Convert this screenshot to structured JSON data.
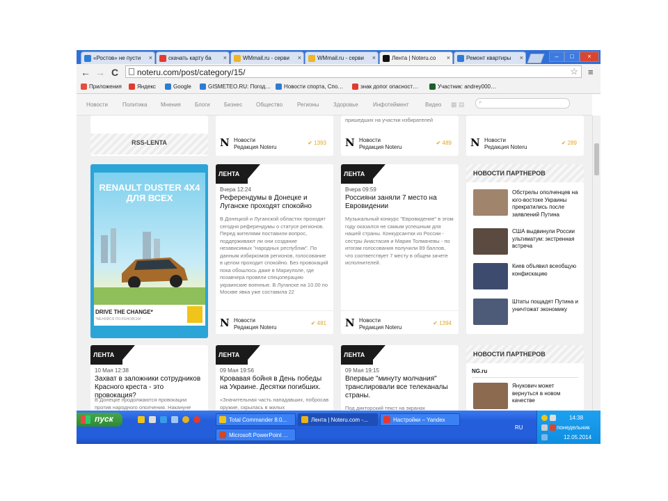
{
  "browser": {
    "tabs": [
      {
        "label": "«Ростов» не пусти",
        "icon_color": "#2e7bd6"
      },
      {
        "label": "скачать карту ба",
        "icon_color": "#e23b2e"
      },
      {
        "label": "WMmail.ru - серви",
        "icon_color": "#f0b429"
      },
      {
        "label": "WMmail.ru - серви",
        "icon_color": "#f0b429"
      },
      {
        "label": "Лента | Noteru.co",
        "icon_color": "#111111"
      },
      {
        "label": "Ремонт квартиры",
        "icon_color": "#2e7bd6"
      }
    ],
    "close_glyph": "×",
    "window_buttons": [
      "–",
      "□",
      "×"
    ],
    "url": "noteru.com/post/category/15/",
    "nav": {
      "back": "←",
      "forward": "→",
      "reload": "C",
      "star": "☆",
      "menu": "≡"
    }
  },
  "bookmarks": [
    {
      "label": "Приложения",
      "icon_color": "#e74c3c"
    },
    {
      "label": "Яндекс",
      "icon_color": "#e23b2e"
    },
    {
      "label": "Google",
      "icon_color": "#2e7bd6"
    },
    {
      "label": "GISMETEO.RU: Погод…",
      "icon_color": "#2e7bd6"
    },
    {
      "label": "Новости спорта, Спо…",
      "icon_color": "#2e7bd6"
    },
    {
      "label": "знак допог опасност…",
      "icon_color": "#e23b2e"
    },
    {
      "label": "Участник: andrey000…",
      "icon_color": "#1a5e2a"
    }
  ],
  "sitenav": [
    "Новости",
    "Политика",
    "Мнения",
    "Блоги",
    "Бизнес",
    "Общество",
    "Регионы",
    "Здоровье",
    "Инфотеймент",
    "Видео"
  ],
  "top_row": {
    "rss_label": "RSS-LENTA",
    "partial_text_3": "пришедших на участки избирателей",
    "cards": [
      {
        "source": "Новости",
        "editor": "Редакция Noteru",
        "count": "1393"
      },
      {
        "source": "Новости",
        "editor": "Редакция Noteru",
        "count": "489"
      },
      {
        "source": "Новости",
        "editor": "Редакция Noteru",
        "count": "289"
      }
    ]
  },
  "ad": {
    "title": "RENAULT DUSTER 4X4 ДЛЯ ВСЕХ",
    "slogan": "DRIVE THE CHANGE*",
    "subtext": "*МЕНЯЙСЯ ПО-РЕНОВСКИ"
  },
  "lenta_label": "ЛЕНТА",
  "mid_row": [
    {
      "date": "Вчера 12:24",
      "title": "Референдумы в Донецке и Луганске проходят спокойно",
      "body": "В Донецкой и Луганской областях проходят сегодня референдумы о статусе регионов. Перед жителями поставили вопрос, поддерживают ли они создание независимых \"народных республик\". По данным избиркомов регионов, голосование в целом проходит спокойно. Без провокаций пока обошлось даже в Мариуполе, где позавчера провели спецоперацию украинские военные. В Луганске на 10.00 по Москве явка уже составила 22",
      "source": "Новости",
      "editor": "Редакция Noteru",
      "count": "481"
    },
    {
      "date": "Вчера 09:59",
      "title": "Россияни заняли 7 место на Евровидении",
      "body": "Музыкальный конкурс \"Евровидение\" в этом году оказался не самым успешным для нашей страны. Конкурсантки из России - сестры Анастасия и Мария Толмачевы - по итогам голосования получили 89 баллов, что соответствует 7 месту в общем зачете исполнителей.",
      "source": "Новости",
      "editor": "Редакция Noteru",
      "count": "1394"
    }
  ],
  "partners1": {
    "title": "НОВОСТИ ПАРТНЕРОВ",
    "items": [
      {
        "text": "Обстрелы ополченцев на юго-востоке Украины прекратились после заявлений Путина",
        "color": "#a0846c"
      },
      {
        "text": "США выдвинули России ультиматум: экстренная встреча",
        "color": "#5b4a3f"
      },
      {
        "text": "Киев объявил всеобщую конфискацию",
        "color": "#3d4c6e"
      },
      {
        "text": "Штаты пощадят Путина и уничтожат экономику",
        "color": "#4d5a78"
      }
    ]
  },
  "bottom_row": [
    {
      "date": "10 Мая 12:38",
      "title": "Захват в заложники сотрудников Красного креста - это провокация?",
      "body": "В Донецке продолжаются провокации против народного ополчения. Накануне"
    },
    {
      "date": "09 Мая 19:56",
      "title": "Кровавая бойня в День победы на Украине. Десятки погибших.",
      "body": "«Значительная часть нападавших, побросав оружие, скрылась в жилых"
    },
    {
      "date": "09 Мая 19:15",
      "title": "Впервые \"минуту молчания\" транслировали все телеканалы страны.",
      "body": "Под дикторский текст на экранах"
    }
  ],
  "partners2": {
    "title": "НОВОСТИ ПАРТНЕРОВ",
    "source": "NG.ru",
    "items": [
      {
        "text": "Янукович может вернуться в новом качестве",
        "color": "#8b6a4f"
      }
    ]
  },
  "taskbar": {
    "start_label": "пуск",
    "buttons": [
      {
        "label": "Total Commander 8.0...",
        "icon_color": "#f0c419",
        "active": false
      },
      {
        "label": "Лента | Noteru.com -...",
        "icon_color": "#e8b21c",
        "active": true
      },
      {
        "label": "Настройки – Yandex",
        "icon_color": "#e23b2e",
        "active": false
      },
      {
        "label": "Microsoft PowerPoint ...",
        "icon_color": "#d24726",
        "active": false
      }
    ],
    "lang": "RU",
    "time": "14:38",
    "weekday": "понедельник",
    "date": "12.05.2014"
  }
}
